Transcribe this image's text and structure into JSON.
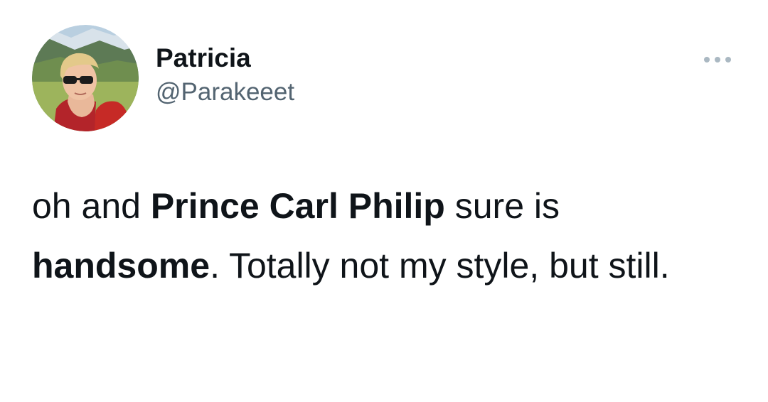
{
  "author": {
    "display_name": "Patricia",
    "handle": "@Parakeeet"
  },
  "icons": {
    "more": "more-horizontal-icon"
  },
  "tweet": {
    "segments": [
      {
        "text": "oh and ",
        "bold": false
      },
      {
        "text": "Prince Carl Philip",
        "bold": true
      },
      {
        "text": " sure is ",
        "bold": false
      },
      {
        "text": "handsome",
        "bold": true
      },
      {
        "text": ". Totally not my style, but still.",
        "bold": false
      }
    ]
  },
  "colors": {
    "text": "#0f1419",
    "secondary": "#536471",
    "icon": "#aab8c2",
    "background": "#ffffff"
  }
}
